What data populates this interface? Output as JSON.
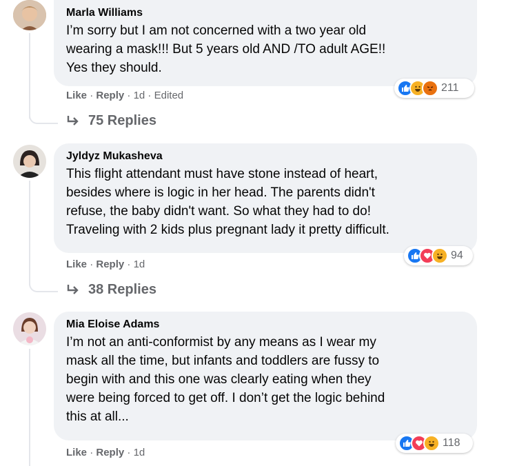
{
  "comments": [
    {
      "author": "Marla Williams",
      "text": "I’m sorry but I am not concerned with a two year old\nwearing a mask!!! But 5 years old AND /TO adult AGE!!\nYes they should.",
      "like": "Like",
      "reply": "Reply",
      "time": "1d",
      "edited": "Edited",
      "reaction_count": "211",
      "reactions": [
        "like-icon",
        "haha-icon",
        "angry-icon"
      ],
      "replies": "75 Replies"
    },
    {
      "author": "Jyldyz Mukasheva",
      "text": "This flight attendant must have stone instead of heart,\nbesides where is logic in her head. The parents didn't\nrefuse, the baby didn't want. So what they had to do!\nTraveling with 2 kids plus pregnant lady it pretty difficult.",
      "like": "Like",
      "reply": "Reply",
      "time": "1d",
      "reaction_count": "94",
      "reactions": [
        "like-icon",
        "love-icon",
        "haha-icon"
      ],
      "replies": "38 Replies"
    },
    {
      "author": "Mia Eloise Adams",
      "text": "I’m not an anti-conformist by any means as I wear my\nmask all the time, but infants and toddlers are fussy to\nbegin with and this one was clearly eating when they\nwere being forced to get off. I don’t get the logic behind\nthis at all...",
      "like": "Like",
      "reply": "Reply",
      "time": "1d",
      "reaction_count": "118",
      "reactions": [
        "like-icon",
        "love-icon",
        "haha-icon"
      ]
    }
  ],
  "separator": "·",
  "colors": {
    "bubble": "#f0f2f5",
    "meta_text": "#65676b",
    "like_blue": "#1877f2",
    "love_red": "#f33e58",
    "haha_yellow": "#f7b125",
    "angry_orange": "#e9710f"
  }
}
